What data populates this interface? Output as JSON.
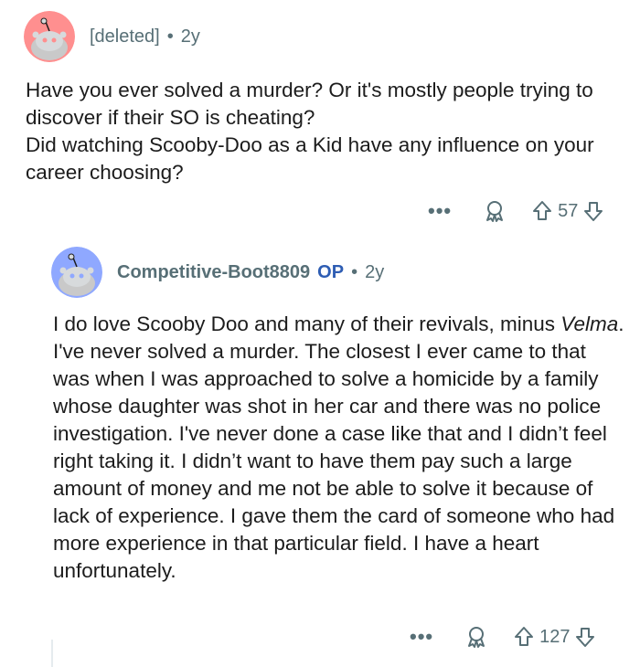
{
  "parent_comment": {
    "username": "[deleted]",
    "separator": "•",
    "age": "2y",
    "body_lines": [
      "Have you ever solved a murder? Or it's mostly people trying to discover if their SO is cheating?",
      "Did watching Scooby-Doo as a Kid have any influence on your career choosing?"
    ],
    "more_label": "•••",
    "score": "57",
    "avatar_color": "#ff8f8f"
  },
  "reply": {
    "username": "Competitive-Boot8809",
    "op_badge": "OP",
    "separator": "•",
    "age": "2y",
    "body_before_italic": "I do love Scooby Doo and many of their revivals, minus ",
    "body_italic": "Velma",
    "body_after_italic": ". I've never solved a murder. The closest I ever came to that was when I was approached to solve a homicide by a family whose daughter was shot in her car and there was no police investigation. I've never done a case like that and I didn’t feel right taking it. I didn’t want to have them pay such a large amount of money and me not be able to solve it because of lack of experience. I gave them the card of someone who had more experience in that particular field. I have a heart unfortunately.",
    "more_label": "•••",
    "score": "127",
    "avatar_color": "#8fa8ff"
  }
}
